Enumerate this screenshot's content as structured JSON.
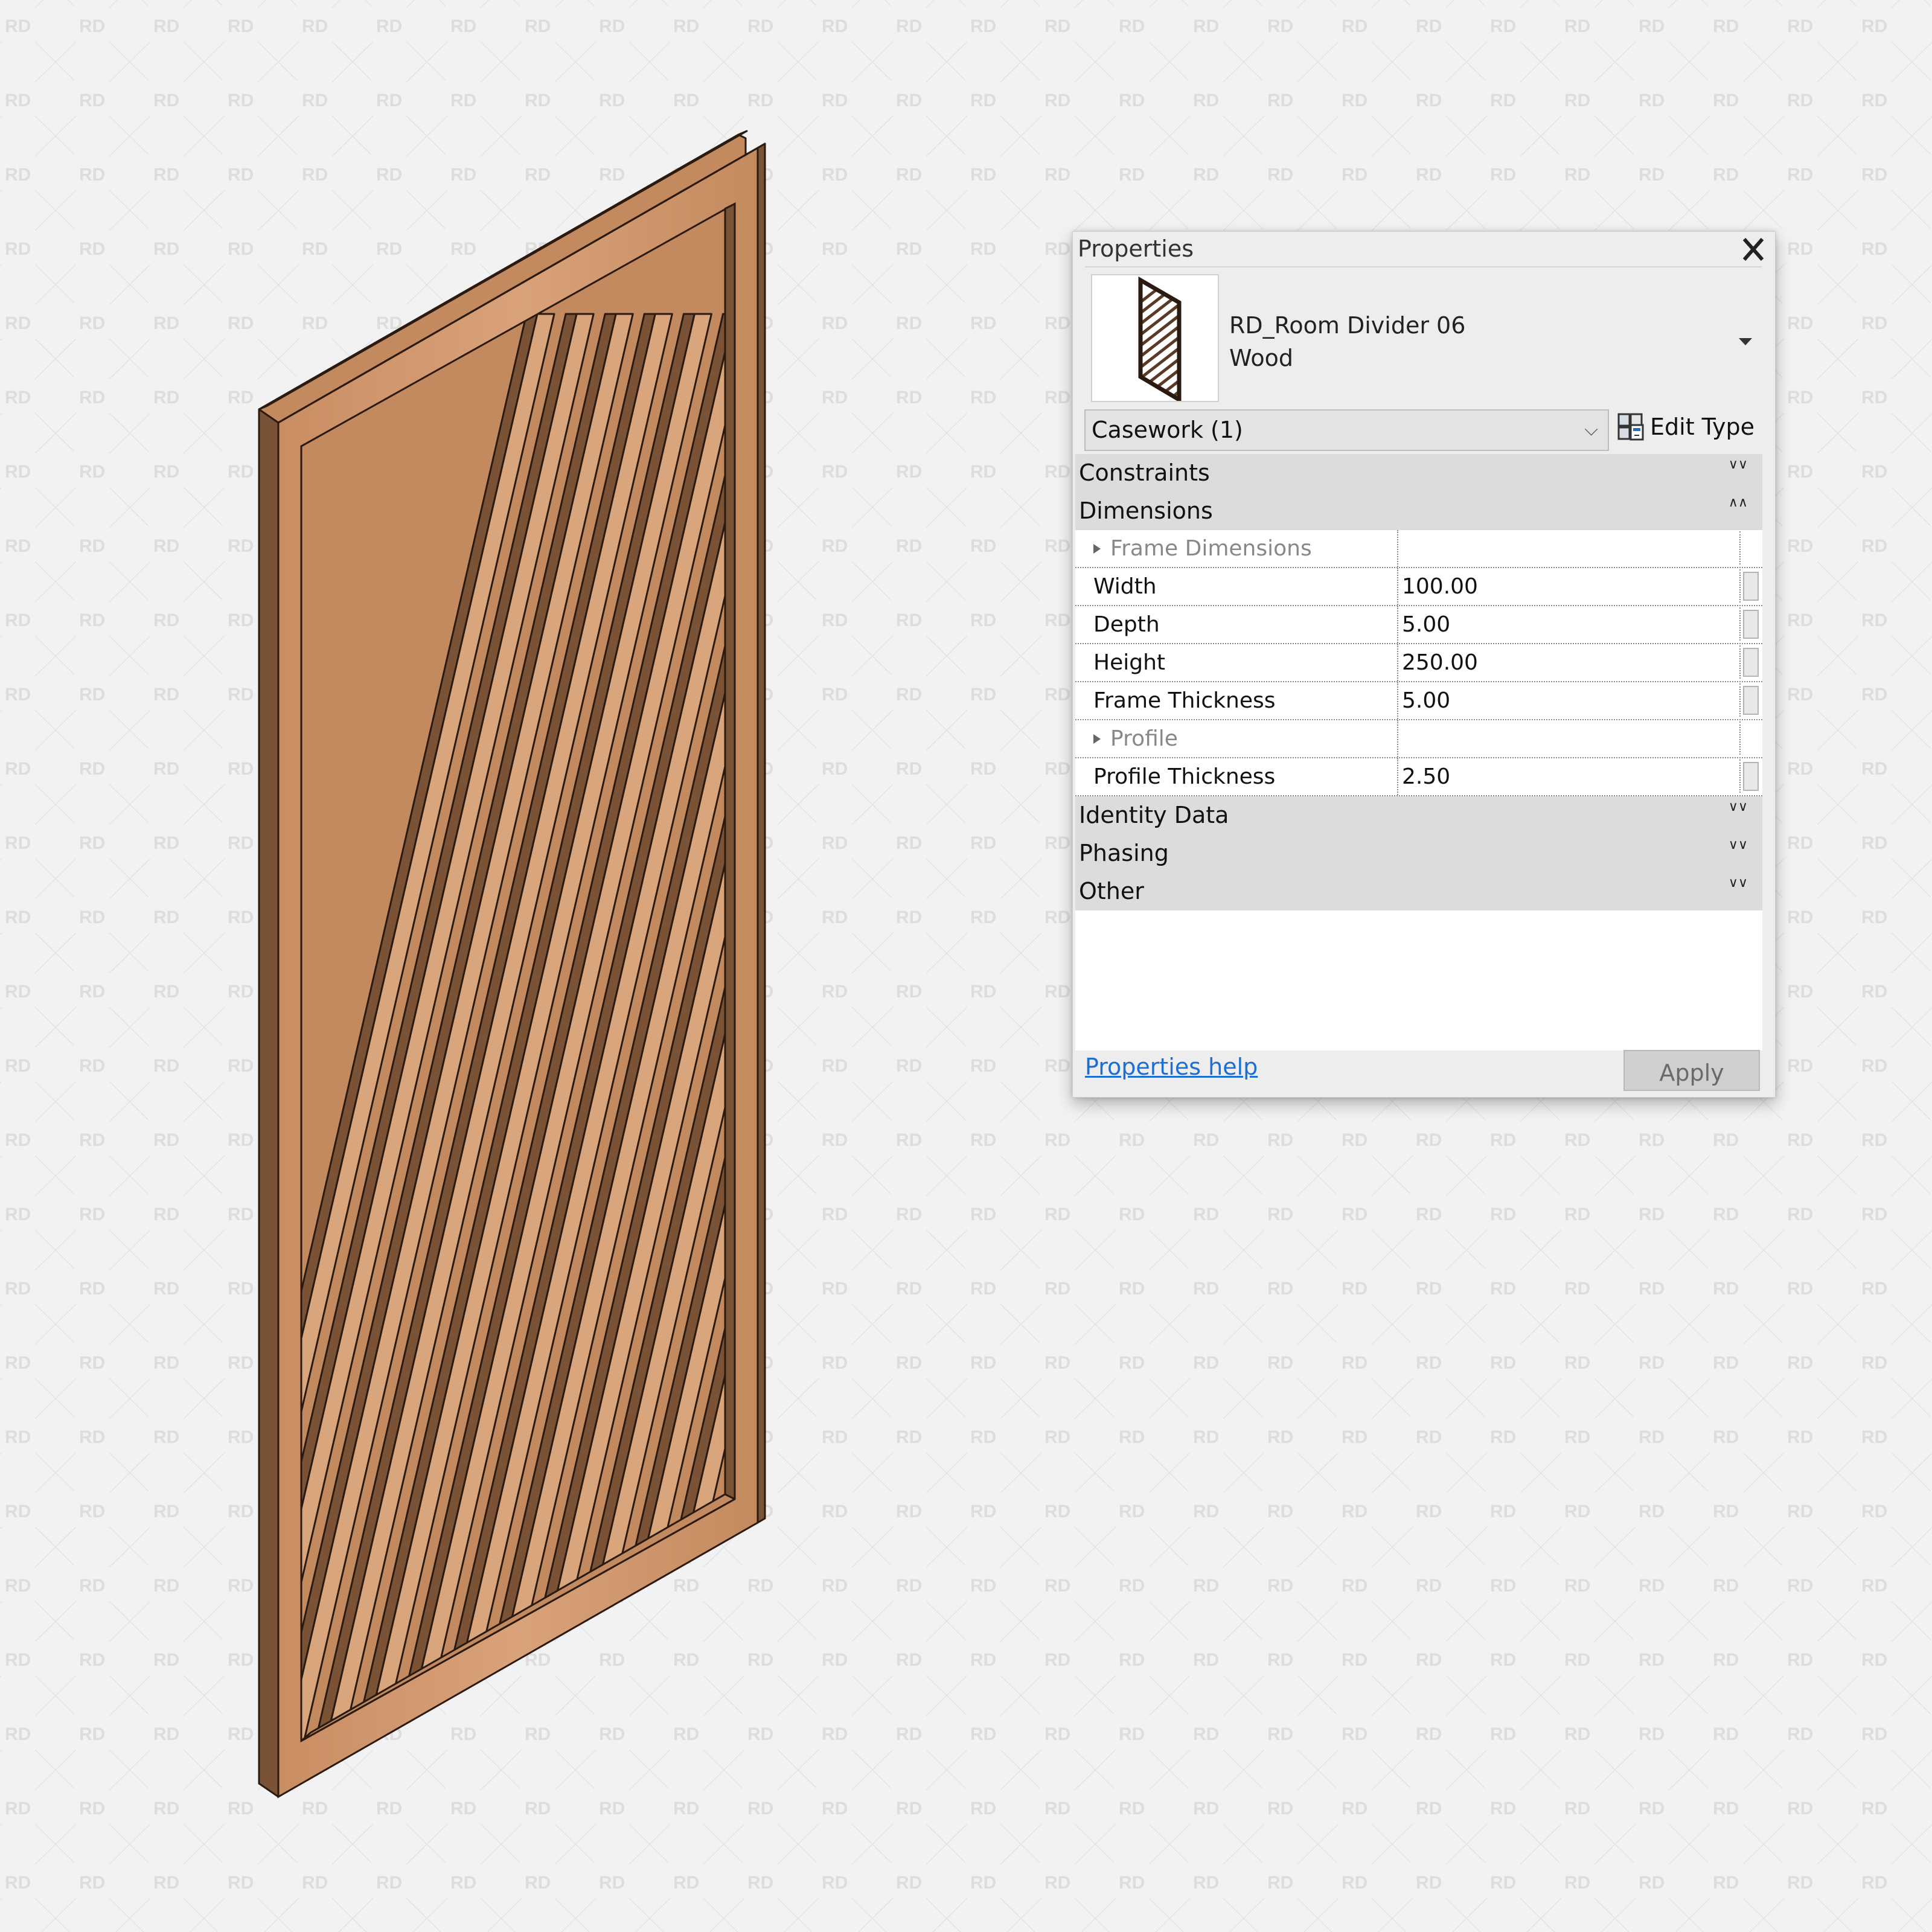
{
  "watermark": {
    "text": "RD",
    "color": "#dcdcdc"
  },
  "viewport": {
    "object_name": "room-divider-06-wood",
    "wood_light": "#d8a57c",
    "wood_mid": "#c48a5f",
    "wood_dark": "#7a5235",
    "edge": "#2a1a10"
  },
  "properties_panel": {
    "title": "Properties",
    "close_icon": "close-icon",
    "type_selector": {
      "family": "RD_Room Divider 06",
      "type": "Wood"
    },
    "category_filter": "Casework (1)",
    "edit_type_label": "Edit Type",
    "groups": [
      {
        "label": "Constraints",
        "state": "collapsed",
        "toggle": "∨∨"
      },
      {
        "label": "Dimensions",
        "state": "expanded",
        "toggle": "∧∧",
        "rows": [
          {
            "name": "Frame Dimensions",
            "subgroup": true,
            "value": ""
          },
          {
            "name": "Width",
            "value": "100.00",
            "associate_button": true
          },
          {
            "name": "Depth",
            "value": "5.00",
            "associate_button": true
          },
          {
            "name": "Height",
            "value": "250.00",
            "associate_button": true
          },
          {
            "name": "Frame Thickness",
            "value": "5.00",
            "associate_button": true
          },
          {
            "name": "Profile",
            "subgroup": true,
            "value": ""
          },
          {
            "name": "Profile Thickness",
            "value": "2.50",
            "associate_button": true
          }
        ]
      },
      {
        "label": "Identity Data",
        "state": "collapsed",
        "toggle": "∨∨"
      },
      {
        "label": "Phasing",
        "state": "collapsed",
        "toggle": "∨∨"
      },
      {
        "label": "Other",
        "state": "collapsed",
        "toggle": "∨∨"
      }
    ],
    "help_link": "Properties help",
    "apply_label": "Apply",
    "apply_enabled": false
  }
}
